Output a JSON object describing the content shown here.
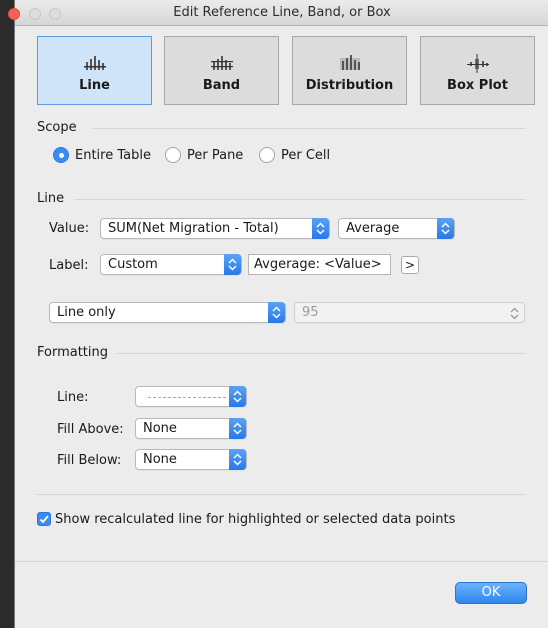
{
  "window": {
    "title": "Edit Reference Line, Band, or Box"
  },
  "types": [
    {
      "label": "Line",
      "icon": "line-chart-icon",
      "selected": true
    },
    {
      "label": "Band",
      "icon": "band-chart-icon",
      "selected": false
    },
    {
      "label": "Distribution",
      "icon": "distribution-chart-icon",
      "selected": false
    },
    {
      "label": "Box Plot",
      "icon": "box-plot-icon",
      "selected": false
    }
  ],
  "scope": {
    "heading": "Scope",
    "options": [
      "Entire Table",
      "Per Pane",
      "Per Cell"
    ],
    "selected": "Entire Table"
  },
  "line": {
    "heading": "Line",
    "value_label": "Value:",
    "value_field": "SUM(Net Migration - Total)",
    "aggregation": "Average",
    "label_label": "Label:",
    "label_type": "Custom",
    "label_text": "Avgerage: <Value>",
    "insert_button": ">",
    "display": "Line only",
    "confidence": "95"
  },
  "formatting": {
    "heading": "Formatting",
    "line_label": "Line:",
    "fill_above_label": "Fill Above:",
    "fill_above_value": "None",
    "fill_below_label": "Fill Below:",
    "fill_below_value": "None"
  },
  "recalc": {
    "label": "Show recalculated line for highlighted or selected data points",
    "checked": true
  },
  "ok_label": "OK",
  "colors": {
    "accent": "#3a8cf2",
    "selected_tile": "#cfe4f8"
  }
}
